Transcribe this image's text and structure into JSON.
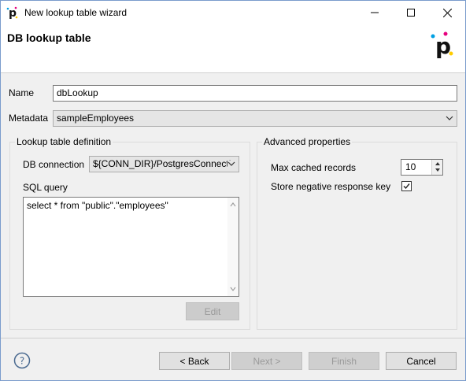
{
  "window": {
    "title": "New lookup table wizard"
  },
  "banner": {
    "title": "DB lookup table"
  },
  "form": {
    "name_label": "Name",
    "name_value": "dbLookup",
    "metadata_label": "Metadata",
    "metadata_value": "sampleEmployees"
  },
  "lookup_group": {
    "title": "Lookup table definition",
    "db_connection_label": "DB connection",
    "db_connection_value": "${CONN_DIR}/PostgresConnecti",
    "sql_query_label": "SQL query",
    "sql_query_value": "select * from \"public\".\"employees\"",
    "edit_button": "Edit"
  },
  "advanced_group": {
    "title": "Advanced properties",
    "max_cached_label": "Max cached records",
    "max_cached_value": "10",
    "store_negative_label": "Store negative response key",
    "store_negative_checked": true
  },
  "footer": {
    "back_button": "< Back",
    "next_button": "Next >",
    "finish_button": "Finish",
    "cancel_button": "Cancel"
  },
  "colors": {
    "logo_magenta": "#e6007e",
    "logo_cyan": "#00a0e3",
    "logo_yellow": "#ffcc00",
    "window_border": "#7a9ccc"
  },
  "icons": {
    "app": "cloverdx-p-icon",
    "minimize": "minimize-icon",
    "maximize": "maximize-icon",
    "close": "close-icon",
    "help": "help-icon",
    "dropdown": "chevron-down-icon",
    "checkbox": "checkmark-icon"
  }
}
